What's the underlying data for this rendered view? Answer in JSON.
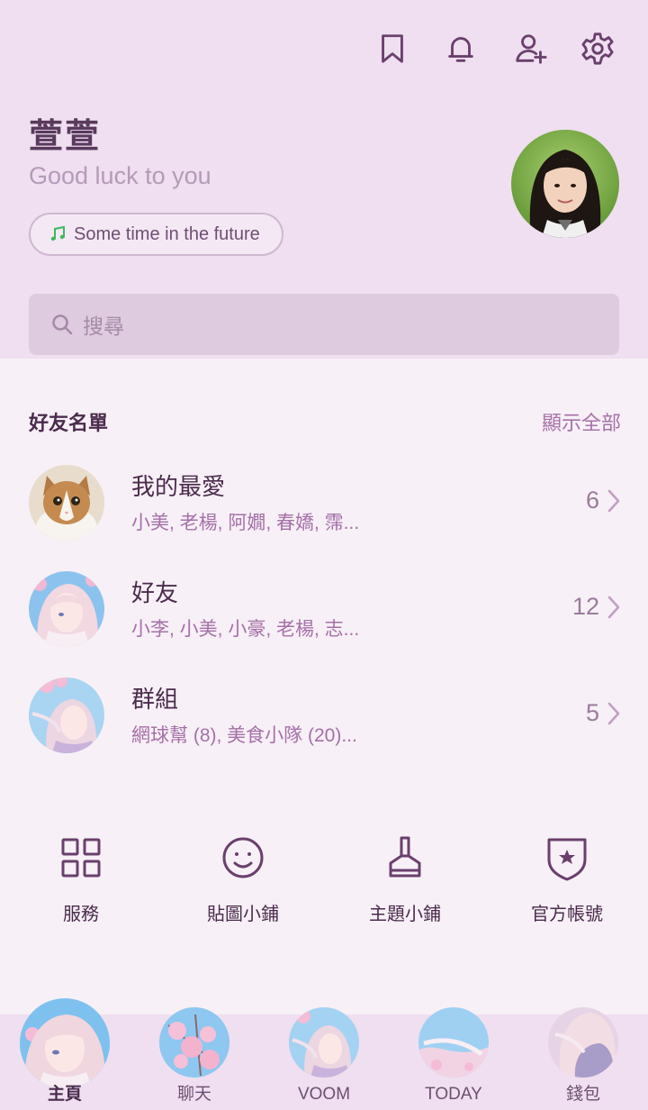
{
  "header": {
    "icons": [
      "bookmark-icon",
      "bell-icon",
      "add-friend-icon",
      "gear-icon"
    ]
  },
  "profile": {
    "name": "萱萱",
    "status": "Good luck to you",
    "music": "Some time in the future"
  },
  "search": {
    "placeholder": "搜尋"
  },
  "friends_section": {
    "title": "好友名單",
    "show_all": "顯示全部",
    "rows": [
      {
        "title": "我的最愛",
        "subtitle": "小美, 老楊, 阿嫺, 春嬌, 霈...",
        "count": "6"
      },
      {
        "title": "好友",
        "subtitle": "小李, 小美, 小豪, 老楊, 志...",
        "count": "12"
      },
      {
        "title": "群組",
        "subtitle": "網球幫 (8), 美食小隊 (20)...",
        "count": "5"
      }
    ]
  },
  "services": [
    {
      "label": "服務",
      "icon": "grid-icon"
    },
    {
      "label": "貼圖小鋪",
      "icon": "smiley-icon"
    },
    {
      "label": "主題小鋪",
      "icon": "brush-icon"
    },
    {
      "label": "官方帳號",
      "icon": "shield-star-icon"
    }
  ],
  "bottom_nav": [
    {
      "label": "主頁",
      "active": true
    },
    {
      "label": "聊天",
      "active": false
    },
    {
      "label": "VOOM",
      "active": false
    },
    {
      "label": "TODAY",
      "active": false
    },
    {
      "label": "錢包",
      "active": false
    }
  ],
  "colors": {
    "header_bg": "#efdff0",
    "accent": "#a570a8",
    "icon": "#6a3f6d"
  }
}
